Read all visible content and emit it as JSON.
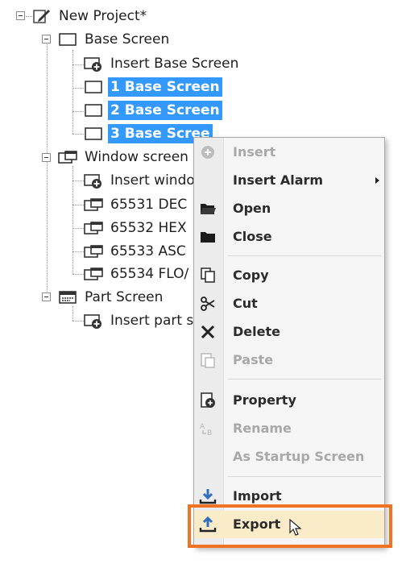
{
  "tree": {
    "root": {
      "label": "New Project*",
      "icon": "project-edit-icon"
    },
    "base_screen": {
      "label": "Base Screen",
      "icon": "screen-icon",
      "items": [
        {
          "label": "Insert Base Screen",
          "icon": "insert-screen-icon",
          "selected": false
        },
        {
          "label": "1 Base Screen",
          "icon": "screen-icon",
          "selected": true
        },
        {
          "label": "2 Base Screen",
          "icon": "screen-icon",
          "selected": true
        },
        {
          "label": "3 Base Scree",
          "icon": "screen-icon",
          "selected": true
        }
      ]
    },
    "window_screen": {
      "label": "Window screen",
      "icon": "window-screen-icon",
      "items": [
        {
          "label": "Insert windo",
          "icon": "insert-screen-icon"
        },
        {
          "label": "65531 DEC",
          "icon": "window-screen-icon"
        },
        {
          "label": "65532 HEX",
          "icon": "window-screen-icon"
        },
        {
          "label": "65533 ASC",
          "icon": "window-screen-icon"
        },
        {
          "label": "65534 FLO/",
          "icon": "window-screen-icon"
        }
      ]
    },
    "part_screen": {
      "label": "Part Screen",
      "icon": "part-screen-icon",
      "items": [
        {
          "label": "Insert part s",
          "icon": "insert-screen-icon"
        }
      ]
    }
  },
  "context_menu": {
    "items": [
      {
        "label": "Insert",
        "icon": "plus-circle-icon",
        "disabled": true
      },
      {
        "label": "Insert Alarm",
        "icon": "",
        "disabled": false,
        "submenu": true
      },
      {
        "label": "Open",
        "icon": "folder-open-icon",
        "disabled": false
      },
      {
        "label": "Close",
        "icon": "folder-closed-icon",
        "disabled": false
      },
      {
        "label": "Copy",
        "icon": "copy-icon",
        "disabled": false
      },
      {
        "label": "Cut",
        "icon": "scissors-icon",
        "disabled": false
      },
      {
        "label": "Delete",
        "icon": "delete-x-icon",
        "disabled": false
      },
      {
        "label": "Paste",
        "icon": "paste-icon",
        "disabled": true
      },
      {
        "label": "Property",
        "icon": "property-icon",
        "disabled": false
      },
      {
        "label": "Rename",
        "icon": "rename-icon",
        "disabled": true
      },
      {
        "label": "As Startup Screen",
        "icon": "",
        "disabled": true
      },
      {
        "label": "Import",
        "icon": "import-icon",
        "disabled": false
      },
      {
        "label": "Export",
        "icon": "export-icon",
        "disabled": false,
        "highlighted": true
      }
    ]
  },
  "colors": {
    "selection": "#3399ff",
    "highlight_outline": "#f07323",
    "hover_fill": "#fbecc9",
    "icon_blue": "#2f6fbe"
  }
}
